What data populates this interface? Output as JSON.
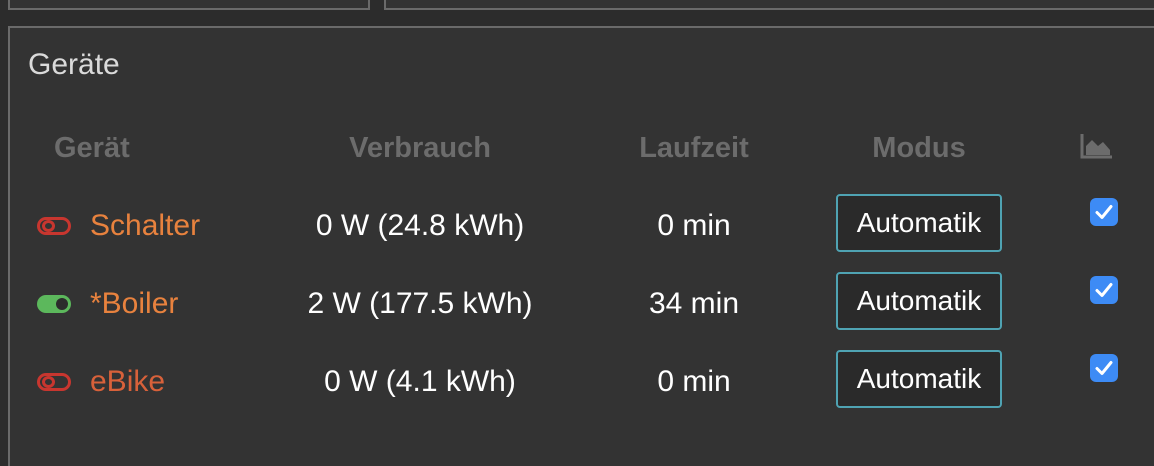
{
  "panel": {
    "title": "Geräte"
  },
  "table": {
    "headers": {
      "device": "Gerät",
      "consumption": "Verbrauch",
      "runtime": "Laufzeit",
      "mode": "Modus",
      "chart_icon": "area-chart-icon"
    },
    "rows": [
      {
        "state": "off",
        "name": "Schalter",
        "name_color": "#e8823e",
        "consumption": "0 W (24.8 kWh)",
        "runtime": "0 min",
        "mode": "Automatik",
        "chart_checked": true
      },
      {
        "state": "on",
        "name": "*Boiler",
        "name_color": "#e8823e",
        "consumption": "2 W (177.5 kWh)",
        "runtime": "34 min",
        "mode": "Automatik",
        "chart_checked": true
      },
      {
        "state": "off",
        "name": "eBike",
        "name_color": "#d8613a",
        "consumption": "0 W (4.1 kWh)",
        "runtime": "0 min",
        "mode": "Automatik",
        "chart_checked": true
      }
    ]
  },
  "colors": {
    "toggle_off": "#c8362f",
    "toggle_on": "#5cb85c",
    "button_border": "#4fa3b3",
    "checkbox": "#3d8bf5"
  }
}
